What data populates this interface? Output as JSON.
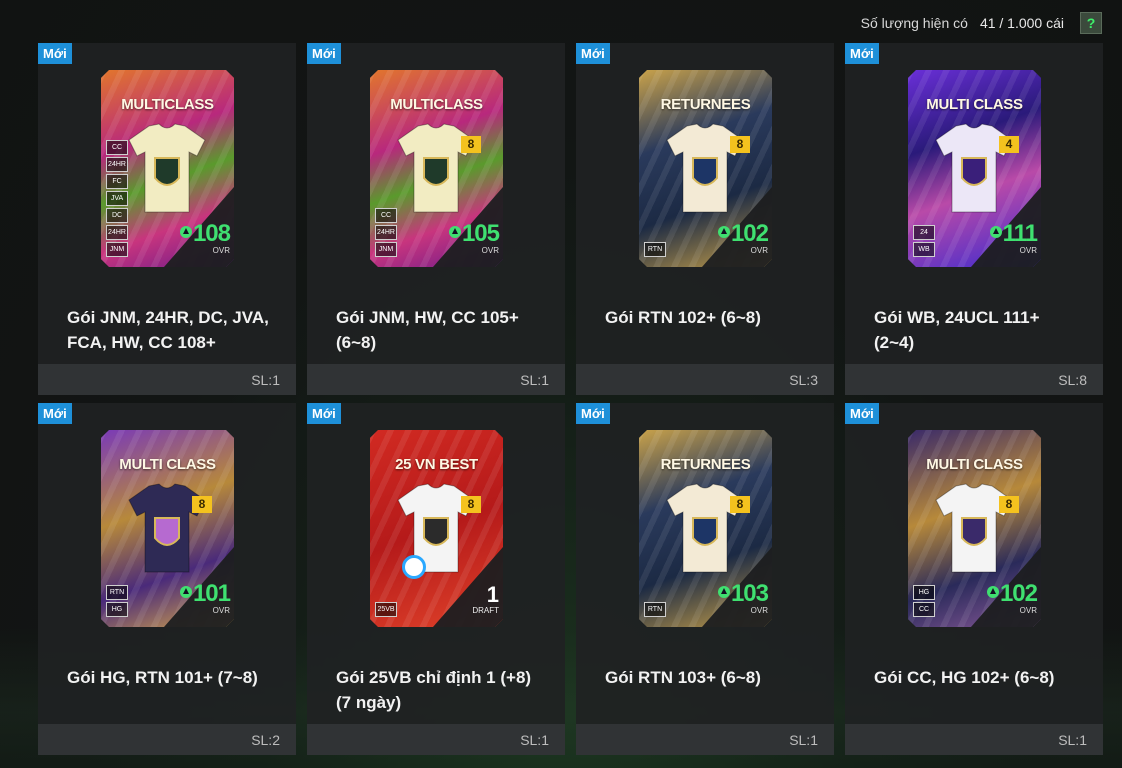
{
  "header": {
    "quantity_label": "Số lượng hiện có",
    "quantity_value": "41 / 1.000 cái",
    "help_label": "?"
  },
  "colors": {
    "badge_blue": "#1e90d9",
    "ovr_green": "#3fe070",
    "level_gold": "#f4c21e"
  },
  "packs": [
    {
      "badge": "Mới",
      "card_title": "MULTICLASS",
      "level": "",
      "chips": [
        "CC",
        "24HR",
        "FC",
        "JVA",
        "DC",
        "24HR",
        "JNM"
      ],
      "ovr": "108",
      "ovr_label": "OVR",
      "name": "Gói JNM, 24HR, DC, JVA, FCA, HW, CC 108+",
      "qty": "SL:1",
      "bg": "linear-gradient(160deg,#e2762c 0%,#b8287d 35%,#5a9a2c 55%,#c8357e 75%,#6a1a8a 100%)",
      "shirt": "#f2ecc2",
      "emblem": "#1f3a2a"
    },
    {
      "badge": "Mới",
      "card_title": "MULTICLASS",
      "level": "8",
      "chips": [
        "CC",
        "24HR",
        "JNM"
      ],
      "ovr": "105",
      "ovr_label": "OVR",
      "name": "Gói JNM, HW, CC 105+ (6~8)",
      "qty": "SL:1",
      "bg": "linear-gradient(160deg,#e2762c 0%,#b8287d 35%,#5a9a2c 55%,#c8357e 75%,#6a1a8a 100%)",
      "shirt": "#f2ecc2",
      "emblem": "#1f3a2a"
    },
    {
      "badge": "Mới",
      "card_title": "RETURNEES",
      "level": "8",
      "chips": [
        "RTN"
      ],
      "ovr": "102",
      "ovr_label": "OVR",
      "name": "Gói RTN 102+ (6~8)",
      "qty": "SL:3",
      "bg": "linear-gradient(160deg,#c9a24a 0%,#2a3a5c 35%,#1c2a44 65%,#c9a24a 100%)",
      "shirt": "#f3ead5",
      "emblem": "#1d3566"
    },
    {
      "badge": "Mới",
      "card_title": "MULTI CLASS",
      "level": "4",
      "chips": [
        "24",
        "WB"
      ],
      "ovr": "111",
      "ovr_label": "OVR",
      "name": "Gói WB, 24UCL 111+ (2~4)",
      "qty": "SL:8",
      "bg": "linear-gradient(160deg,#6a2fd8 0%,#2a1a7a 35%,#b94aa8 60%,#3a2ad0 100%)",
      "shirt": "#ece7f7",
      "emblem": "#3a1f7a"
    },
    {
      "badge": "Mới",
      "card_title": "MULTI CLASS",
      "level": "8",
      "chips": [
        "RTN",
        "HG"
      ],
      "ovr": "101",
      "ovr_label": "OVR",
      "name": "Gói HG, RTN 101+ (7~8)",
      "qty": "SL:2",
      "bg": "linear-gradient(160deg,#7a3ab8 0%,#b7893a 40%,#4a2a7a 70%,#d7a84a 100%)",
      "shirt": "#2e2a55",
      "emblem": "#b66ad0"
    },
    {
      "badge": "Mới",
      "card_title": "25 VN BEST",
      "level": "8",
      "chips": [
        "25VB"
      ],
      "ovr": "1",
      "ovr_label": "DRAFT",
      "name": "Gói 25VB chỉ định 1 (+8) (7 ngày)",
      "qty": "SL:1",
      "bg": "linear-gradient(160deg,#d12a22 0%,#b51a1a 50%,#e0422a 100%)",
      "shirt": "#f4f4f4",
      "emblem": "#2b2b2b",
      "draft": true
    },
    {
      "badge": "Mới",
      "card_title": "RETURNEES",
      "level": "8",
      "chips": [
        "RTN"
      ],
      "ovr": "103",
      "ovr_label": "OVR",
      "name": "Gói RTN 103+ (6~8)",
      "qty": "SL:1",
      "bg": "linear-gradient(160deg,#c9a24a 0%,#2a3a5c 35%,#1c2a44 65%,#c9a24a 100%)",
      "shirt": "#f3ead5",
      "emblem": "#1d3566"
    },
    {
      "badge": "Mới",
      "card_title": "MULTI CLASS",
      "level": "8",
      "chips": [
        "HG",
        "CC"
      ],
      "ovr": "102",
      "ovr_label": "OVR",
      "name": "Gói CC, HG 102+ (6~8)",
      "qty": "SL:1",
      "bg": "linear-gradient(160deg,#3a2a6a 0%,#b7893a 40%,#2a2a5a 70%,#8a5a9a 100%)",
      "shirt": "#f4f4f4",
      "emblem": "#3a2a6a"
    }
  ]
}
